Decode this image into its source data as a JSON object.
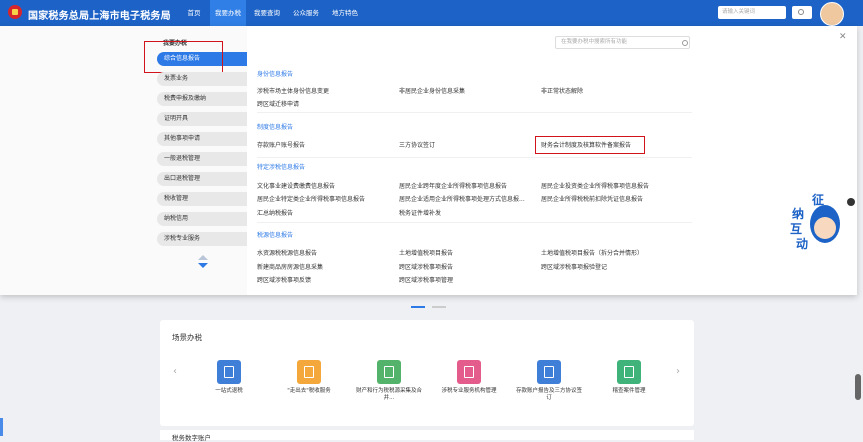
{
  "header": {
    "site_title": "国家税务总局上海市电子税务局",
    "nav": [
      "首页",
      "我要办税",
      "我要查询",
      "公众服务",
      "地方特色"
    ],
    "search_placeholder": "请输入关键词"
  },
  "menu": {
    "title": "我要办税",
    "categories": [
      "综合信息报告",
      "发票业务",
      "税费申报及缴纳",
      "证明开具",
      "其他事项申请",
      "一般退税管理",
      "出口退税管理",
      "税收管理",
      "纳税信用",
      "涉税专业服务"
    ],
    "active_category": "综合信息报告",
    "function_search_placeholder": "在我要办税中搜索所有功能",
    "sections": [
      {
        "title": "身份信息报告",
        "items": [
          "涉税市场主体身份信息变更",
          "非居民企业身份信息采集",
          "非正常状态解除",
          "跨区域迁移申请"
        ]
      },
      {
        "title": "制度信息报告",
        "items": [
          "存款账户账号报告",
          "三方协议签订",
          "财务会计制度及核算软件备案报告"
        ]
      },
      {
        "title": "特定涉税信息报告",
        "items": [
          "文化事业建设费缴费信息报告",
          "居民企业跨年度企业所得税事项信息报告",
          "居民企业投资类企业所得税事项信息报告",
          "居民企业特定类企业所得税事项信息报告",
          "居民企业适用企业所得税事项处理方式信息报...",
          "居民企业所得税税前扣除凭证信息报告",
          "汇总纳税报告",
          "税务证件增补发"
        ]
      },
      {
        "title": "税源信息报告",
        "items": [
          "水资源税税源信息报告",
          "土地增值税项目报告",
          "土地增值税项目报告（拆分合并情形）",
          "新建商品房房源信息采集",
          "跨区域涉税事项报告",
          "跨区域涉税事项报验登记",
          "跨区域涉税事项反馈",
          "跨区域涉税事项管理"
        ]
      }
    ]
  },
  "scenario": {
    "title": "场景办税",
    "items": [
      "一站式退税",
      "\"走出去\"税收服务",
      "财产和行为税税源采集及合并...",
      "涉税专业服务机构管理",
      "存款账户报告及三方协议签订",
      "稽查案件管理"
    ]
  },
  "bottom": {
    "title": "税务数字账户"
  },
  "mascot": {
    "chars": [
      "征",
      "纳",
      "互",
      "动"
    ]
  },
  "colors": {
    "brand": "#1d62c6",
    "accent": "#2d7ae6",
    "highlight": "#d0141b"
  }
}
